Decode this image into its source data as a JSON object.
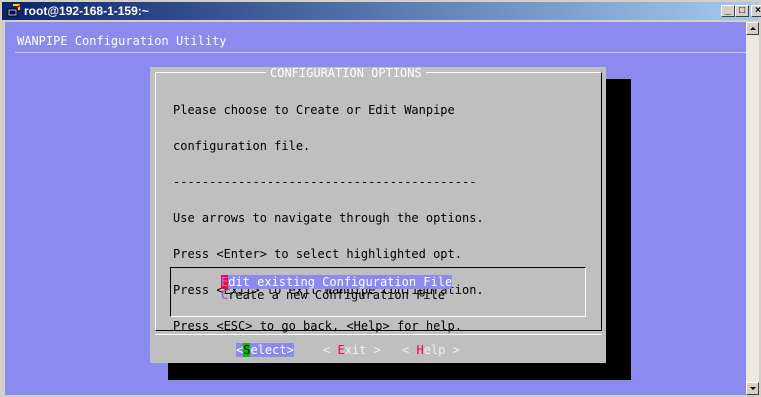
{
  "window": {
    "title": "root@192-168-1-159:~",
    "minimize_label": "_",
    "maximize_label": "□",
    "close_label": "×"
  },
  "terminal": {
    "util_title": "WANPIPE Configuration Utility"
  },
  "dialog": {
    "title": "CONFIGURATION OPTIONS",
    "lines": [
      "Please choose to Create or Edit Wanpipe",
      "configuration file.",
      "------------------------------------------",
      "Use arrows to navigate through the options.",
      "Press <Enter> to select highlighted opt.",
      "Press <Exit> to exit Wanpipe configuration.",
      "Press <ESC> to go back, <Help> for help."
    ],
    "menu": [
      {
        "hotkey": "E",
        "label": "dit existing Configuration File",
        "selected": true
      },
      {
        "hotkey": "C",
        "label": "reate a new Configuration File",
        "selected": false
      }
    ],
    "buttons": {
      "select": {
        "pre": "<",
        "hotkey": "S",
        "post": "elect>"
      },
      "exit": {
        "pre": "< ",
        "hotkey": "E",
        "post": "xit >"
      },
      "help": {
        "pre": "< ",
        "hotkey": "H",
        "post": "elp >"
      }
    }
  },
  "colors": {
    "terminal_bg": "#8b8bef",
    "dialog_bg": "#bfbfbf",
    "hotkey": "#ff0040",
    "select_hotkey_bg": "#00c000"
  },
  "icons": {
    "title_icon": "putty-terminal-icon"
  }
}
